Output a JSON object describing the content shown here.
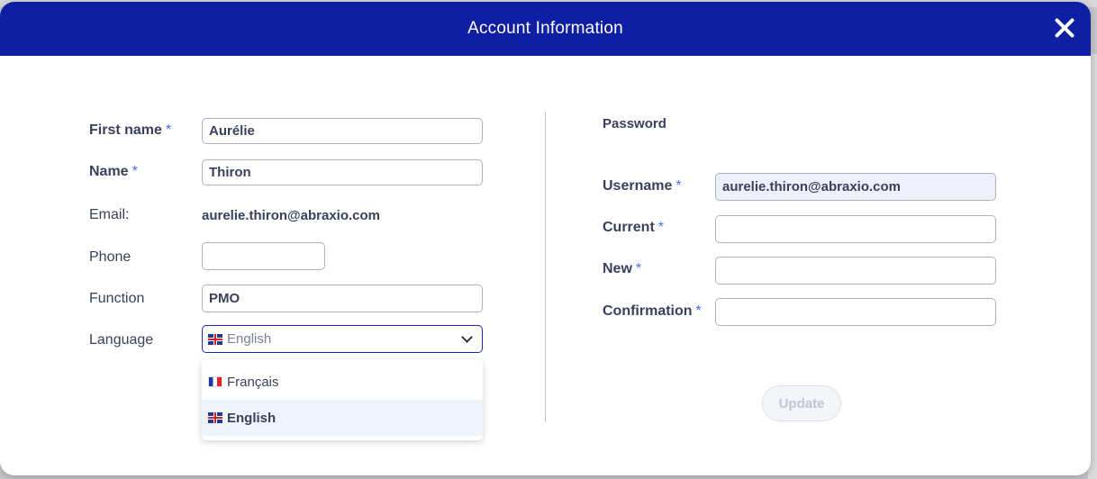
{
  "modal": {
    "title": "Account Information"
  },
  "profile": {
    "first_name": {
      "label": "First name",
      "required": "*",
      "value": "Aurélie"
    },
    "name": {
      "label": "Name",
      "required": "*",
      "value": "Thiron"
    },
    "email": {
      "label": "Email:",
      "value": "aurelie.thiron@abraxio.com"
    },
    "phone": {
      "label": "Phone",
      "value": ""
    },
    "function": {
      "label": "Function",
      "value": "PMO"
    },
    "language": {
      "label": "Language",
      "selected": "English",
      "options": [
        {
          "label": "Français",
          "flag": "fr-flag-icon"
        },
        {
          "label": "English",
          "flag": "uk-flag-icon"
        }
      ]
    }
  },
  "password": {
    "title": "Password",
    "username": {
      "label": "Username",
      "required": "*",
      "value": "aurelie.thiron@abraxio.com"
    },
    "current": {
      "label": "Current",
      "required": "*",
      "value": ""
    },
    "new": {
      "label": "New",
      "required": "*",
      "value": ""
    },
    "confirmation": {
      "label": "Confirmation",
      "required": "*",
      "value": ""
    },
    "update_label": "Update"
  },
  "colors": {
    "header": "#0f1fa3",
    "required": "#4a6cf0"
  }
}
